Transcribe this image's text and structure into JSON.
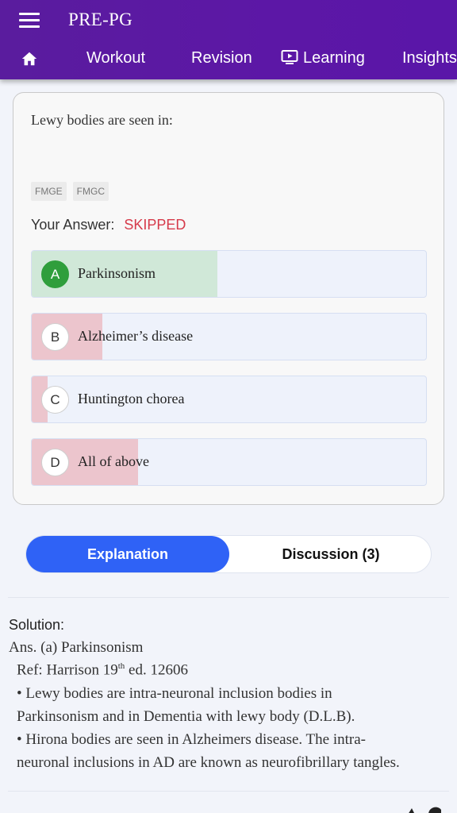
{
  "app": {
    "title": "PRE-PG"
  },
  "nav": {
    "home_icon": "home-icon",
    "tabs": [
      {
        "label": "Workout"
      },
      {
        "label": "Revision"
      },
      {
        "label": "Learning",
        "icon": "tv-play-icon"
      },
      {
        "label": "Insights"
      }
    ]
  },
  "question": {
    "text": "Lewy bodies are seen in:",
    "tags": [
      "FMGE",
      "FMGC"
    ],
    "answer_label": "Your Answer:",
    "answer_status": "SKIPPED",
    "options": [
      {
        "letter": "A",
        "text": "Parkinsonism",
        "percent": 47,
        "state": "correct"
      },
      {
        "letter": "B",
        "text": "Alzheimer’s disease",
        "percent": 18,
        "state": "wrong"
      },
      {
        "letter": "C",
        "text": "Huntington chorea",
        "percent": 4,
        "state": "wrong"
      },
      {
        "letter": "D",
        "text": "All of above",
        "percent": 27,
        "state": "wrong"
      }
    ]
  },
  "tabs": {
    "explanation": "Explanation",
    "discussion": "Discussion (3)"
  },
  "solution": {
    "heading": "Solution:",
    "answer": "Ans. (a) Parkinsonism",
    "ref_prefix": "Ref: Harrison 19",
    "ref_sup": "th",
    "ref_suffix": " ed. 12606",
    "bullet1_line1": "•  Lewy bodies are intra-neuronal inclusion bodies in",
    "bullet1_line2": "Parkinsonism and in Dementia with lewy body (D.L.B).",
    "bullet2_line1": "•  Hirona bodies are seen in Alzheimers disease. The intra-",
    "bullet2_line2": "neuronal inclusions in AD are known as neurofibrillary tangles."
  },
  "colors": {
    "appbar": "#5a1c9e",
    "correct": "#2f9e3c",
    "skipped": "#d63a4a",
    "accent_blue": "#2f62f6"
  }
}
